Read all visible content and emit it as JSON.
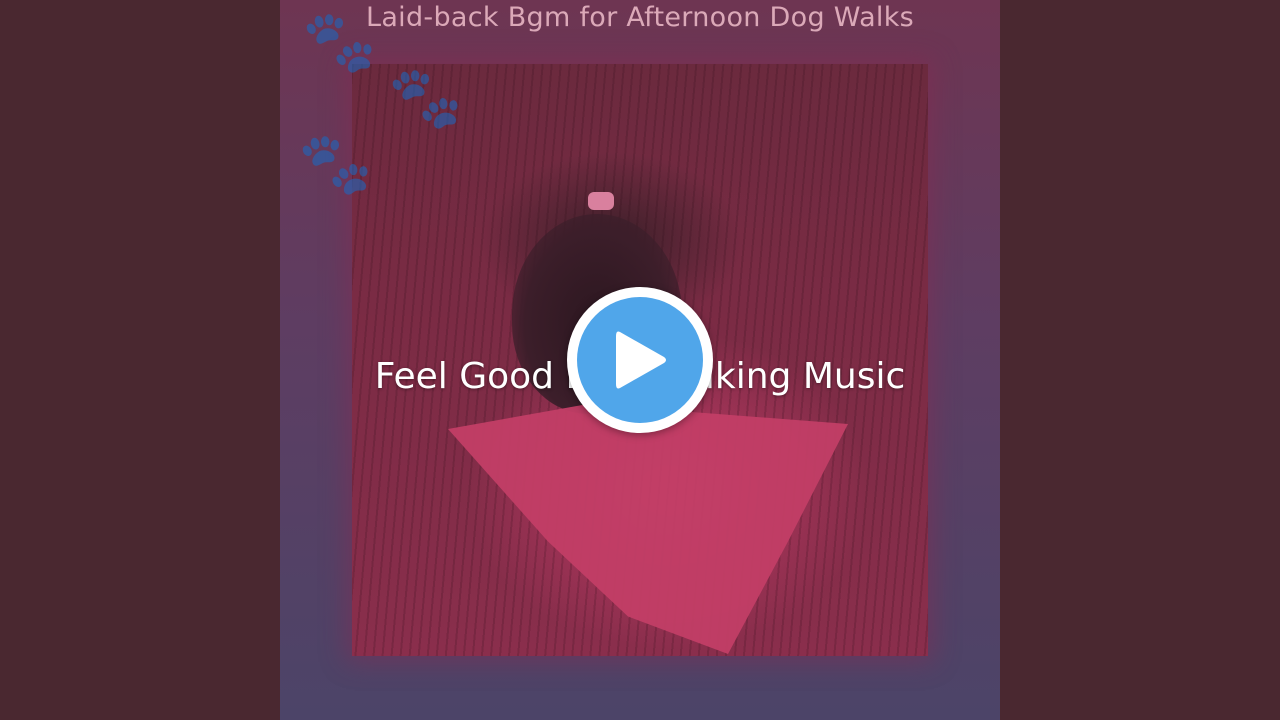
{
  "video": {
    "album_title": "Laid-back Bgm for Afternoon Dog Walks",
    "track_title": "Feel Good Dog Walking Music"
  },
  "player": {
    "play_icon": "play-icon",
    "accent_color": "#50a6ea"
  },
  "decor": {
    "paw_icon": "paw-icon",
    "paw_glyph": "🐾"
  }
}
